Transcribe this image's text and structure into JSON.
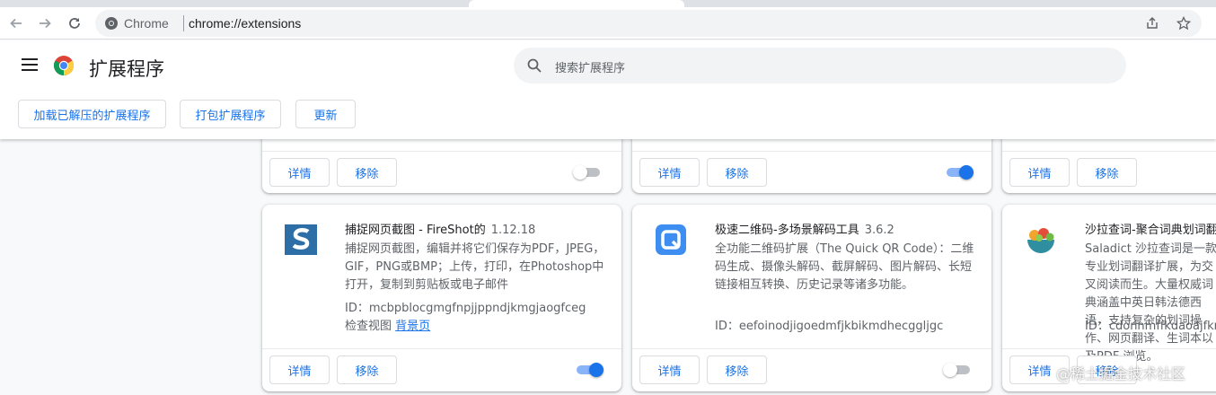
{
  "browser": {
    "site_label": "Chrome",
    "url": "chrome://extensions"
  },
  "header": {
    "title": "扩展程序",
    "search_placeholder": "搜索扩展程序",
    "buttons": {
      "load_unpacked": "加载已解压的扩展程序",
      "pack": "打包扩展程序",
      "update": "更新"
    }
  },
  "card_buttons": {
    "details": "详情",
    "remove": "移除"
  },
  "top_row": [
    {
      "enabled": false
    },
    {
      "enabled": true
    },
    {
      "enabled": null
    }
  ],
  "extensions": [
    {
      "name": "捕捉网页截图 - FireShot的",
      "version": "1.12.18",
      "description": "捕捉网页截图，编辑并将它们保存为PDF，JPEG，GIF，PNG或BMP；上传，打印，在Photoshop中打开，复制到剪贴板或电子邮件",
      "id": "ID：mcbpblocgmgfnpjjppndjkmgjaogfceg",
      "inspect_label": "检查视图",
      "inspect_link": "背景页",
      "enabled": true,
      "icon": "fireshot-icon"
    },
    {
      "name": "极速二维码-多场景解码工具",
      "version": "3.6.2",
      "description": "全功能二维码扩展（The Quick QR Code）：二维码生成、摄像头解码、截屏解码、图片解码、长短链接相互转换、历史记录等诸多功能。",
      "id": "ID：eefoinodjigoedmfjkbikmdhecggljgc",
      "enabled": false,
      "icon": "qr-code-icon"
    },
    {
      "name": "沙拉查词-聚合词典划词翻",
      "version": "",
      "description": "Saladict 沙拉查词是一款专业划词翻译扩展，为交叉阅读而生。大量权威词典涵盖中英日韩法德西语，支持复杂的划词操作、网页翻译、生词本以及PDF 浏览。",
      "id": "ID：cdonnmffkdaoajfknoeeecmchibpmkmg",
      "enabled": null,
      "icon": "saladict-icon"
    }
  ],
  "watermark": "@稀土掘金技术社区",
  "colors": {
    "accent": "#1a73e8",
    "toggle_on_track": "#8ab4f8",
    "page_bg": "#f8f9fa"
  }
}
